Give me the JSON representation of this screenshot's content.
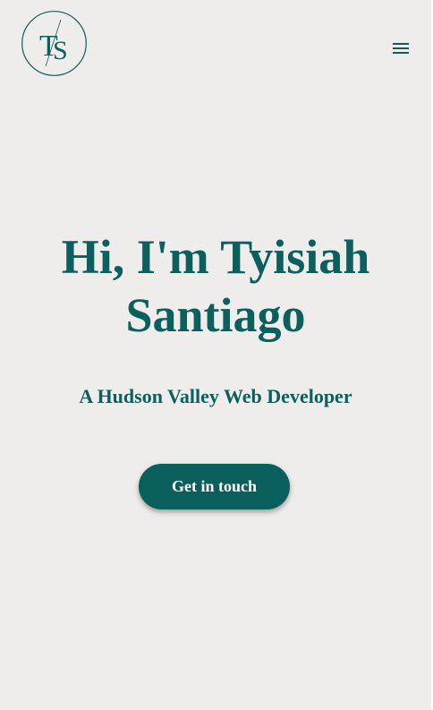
{
  "header": {
    "logo_text": "TS",
    "menu_icon": "hamburger-menu-icon"
  },
  "hero": {
    "title": "Hi, I'm Tyisiah Santiago",
    "subtitle": "A Hudson Valley Web Developer",
    "cta_label": "Get in touch"
  },
  "colors": {
    "background": "#efedeb",
    "accent": "#0b5f5d",
    "button_text": "#ffffff"
  }
}
